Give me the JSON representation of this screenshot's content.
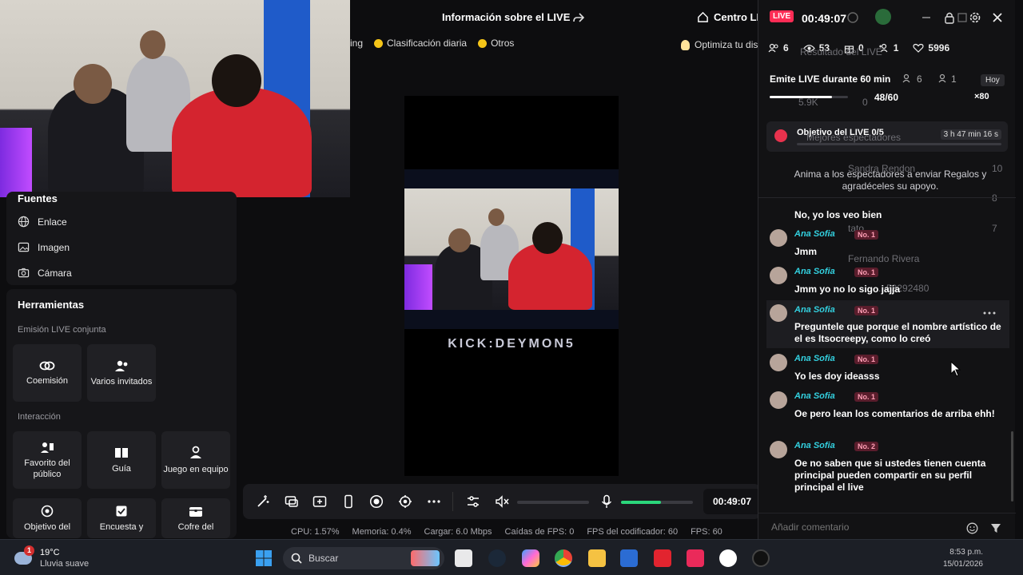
{
  "colors": {
    "accent_live": "#fe2c55",
    "cyan_name": "#33d1e0",
    "green": "#2bd67b"
  },
  "top": {
    "title": "Información sobre el LIVE",
    "centro": "Centro LIVE",
    "chips": [
      "ing",
      "Clasificación diaria",
      "Otros"
    ],
    "optimiza": "Optimiza tu dise"
  },
  "left": {
    "fuentes": "Fuentes",
    "items": [
      {
        "label": "Enlace",
        "icon": "globe-icon"
      },
      {
        "label": "Imagen",
        "icon": "image-icon"
      },
      {
        "label": "Cámara",
        "icon": "camera-icon"
      }
    ],
    "herramientas": "Herramientas",
    "emision": "Emisión LIVE conjunta",
    "coemision": "Coemisión",
    "varios": "Varios invitados",
    "interaccion": "Interacción",
    "favorito": "Favorito del público",
    "guia": "Guía",
    "juego": "Juego en equipo",
    "objetivo": "Objetivo del",
    "encuesta": "Encuesta y",
    "cofre": "Cofre del"
  },
  "video": {
    "overlay_text": "KICK:DEYMON5"
  },
  "controls": {
    "timer": "00:49:07",
    "mic_level": 0.55
  },
  "stats": {
    "cpu": "CPU: 1.57%",
    "memoria": "Memoria: 0.4%",
    "cargar": "Cargar: 6.0 Mbps",
    "caidas": "Caídas de FPS: 0",
    "fps_cod": "FPS del codificador: 60",
    "fps": "FPS: 60"
  },
  "panel": {
    "live_badge": "LIVE",
    "time": "00:49:07",
    "counts": {
      "viewers": "6",
      "views": "53",
      "gifts": "0",
      "new": "1",
      "likes": "5996"
    },
    "goal": "Emite LIVE durante 60 min",
    "goal_progress": 0.8,
    "goal_value": "48/60",
    "goal_people": "6",
    "goal_person": "1",
    "hoy": "Hoy",
    "x80": "×80",
    "objective_title": "Objetivo del LIVE 0/5",
    "objective_time": "3 h 47 min 16 s",
    "objective_hint": "Anima a los espectadores a enviar Regalos y agradéceles su apoyo.",
    "ghost": {
      "resultado": "Resultado del LIVE",
      "likes": "5.9K",
      "gifts": "0",
      "mejores": "Mejores espectadores",
      "viewer1": "Sandra Rendon",
      "n1": "10",
      "viewer2": "Ana Sofia",
      "n2": "8",
      "viewer3": "tato",
      "n3": "7",
      "viewer4": "Fernando Rivera",
      "viewer5": "...53292480"
    },
    "messages": [
      {
        "name": "Ana Sofia",
        "badge": "No. 1",
        "text": "No, yo los veo bien"
      },
      {
        "name": "Ana Sofia",
        "badge": "No. 1",
        "text": "Jmm"
      },
      {
        "name": "Ana Sofia",
        "badge": "No. 1",
        "text": "Jmm yo no lo sigo jajja"
      },
      {
        "name": "Ana Sofia",
        "badge": "No. 1",
        "text": "Preguntele que porque el nombre artístico de el es Itsocreepy, como lo creó"
      },
      {
        "name": "Ana Sofia",
        "badge": "No. 1",
        "text": "Yo les doy ideasss"
      },
      {
        "name": "Ana Sofia",
        "badge": "No. 1",
        "text": "Oe pero lean los comentarios de arriba ehh!"
      },
      {
        "name": "Ana Sofia",
        "badge": "No. 2",
        "text": "Oe no saben que si ustedes tienen cuenta principal pueden compartir en su perfil principal el live"
      }
    ],
    "comment_placeholder": "Añadir comentario"
  },
  "taskbar": {
    "weather_temp": "19°C",
    "weather_cond": "Lluvia suave",
    "weather_badge": "1",
    "search": "Buscar",
    "time": "8:53 p.m.",
    "date": "15/01/2026"
  }
}
